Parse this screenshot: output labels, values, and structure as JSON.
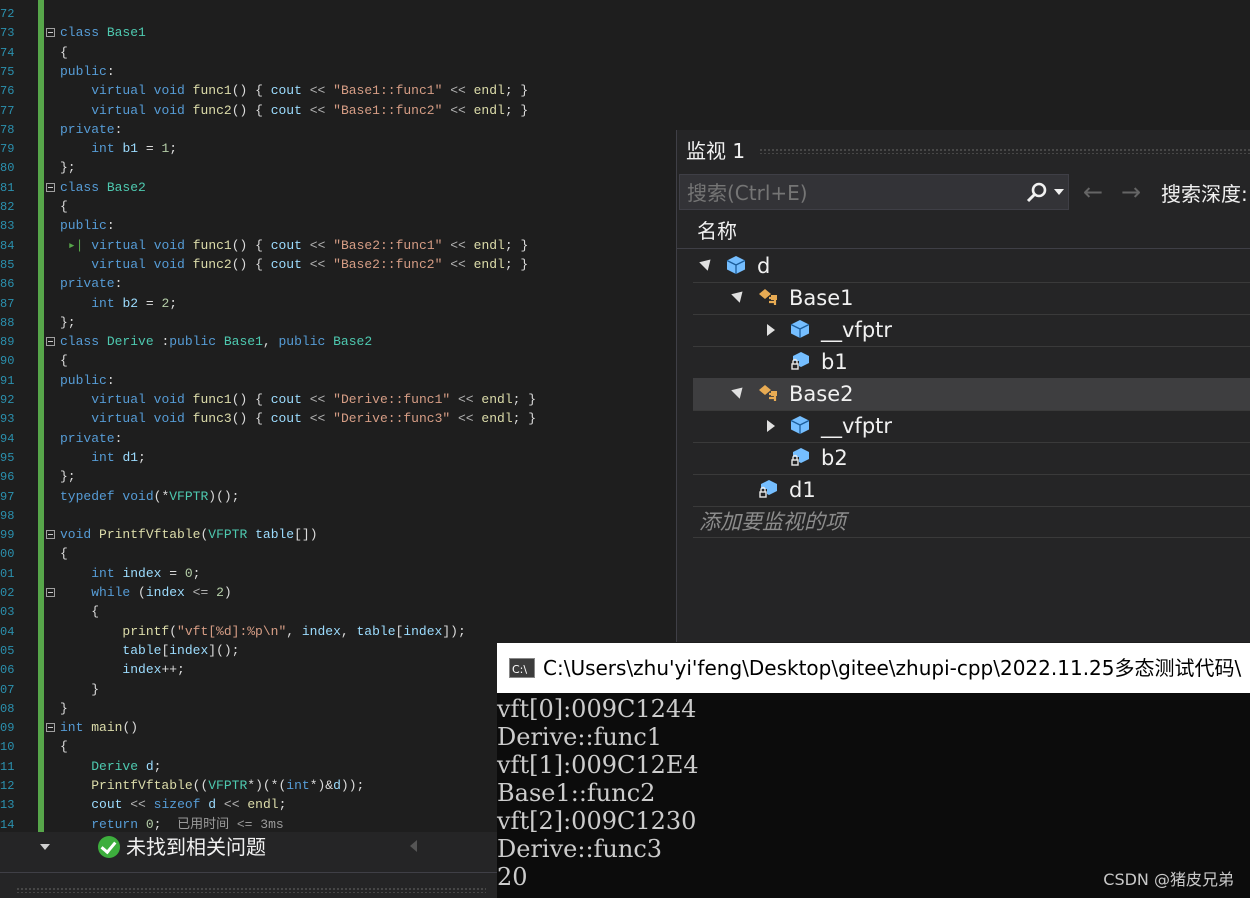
{
  "editor": {
    "lines": [
      {
        "n": "72",
        "html": ""
      },
      {
        "n": "73",
        "fold": true,
        "html": "<span class='kw'>class</span> <span class='ty'>Base1</span>"
      },
      {
        "n": "74",
        "html": "{"
      },
      {
        "n": "75",
        "html": "<span class='kw'>public</span>:"
      },
      {
        "n": "76",
        "html": "    <span class='kw'>virtual</span> <span class='kw'>void</span> <span class='fn'>func1</span>() { <span class='va'>cout</span> <span class='op'>&lt;&lt;</span> <span class='st'>\"Base1::func1\"</span> <span class='op'>&lt;&lt;</span> <span class='fn'>endl</span>; }"
      },
      {
        "n": "77",
        "html": "    <span class='kw'>virtual</span> <span class='kw'>void</span> <span class='fn'>func2</span>() { <span class='va'>cout</span> <span class='op'>&lt;&lt;</span> <span class='st'>\"Base1::func2\"</span> <span class='op'>&lt;&lt;</span> <span class='fn'>endl</span>; }"
      },
      {
        "n": "78",
        "html": "<span class='kw'>private</span>:"
      },
      {
        "n": "79",
        "html": "    <span class='kw'>int</span> <span class='va'>b1</span> = <span class='nu'>1</span>;"
      },
      {
        "n": "80",
        "html": "};"
      },
      {
        "n": "81",
        "fold": true,
        "html": "<span class='kw'>class</span> <span class='ty'>Base2</span>"
      },
      {
        "n": "82",
        "html": "{"
      },
      {
        "n": "83",
        "html": "<span class='kw'>public</span>:"
      },
      {
        "n": "84",
        "html": " <span class='bp'>▸|</span> <span class='kw'>virtual</span> <span class='kw'>void</span> <span class='fn'>func1</span>() { <span class='va'>cout</span> <span class='op'>&lt;&lt;</span> <span class='st'>\"Base2::func1\"</span> <span class='op'>&lt;&lt;</span> <span class='fn'>endl</span>; }"
      },
      {
        "n": "85",
        "html": "    <span class='kw'>virtual</span> <span class='kw'>void</span> <span class='fn'>func2</span>() { <span class='va'>cout</span> <span class='op'>&lt;&lt;</span> <span class='st'>\"Base2::func2\"</span> <span class='op'>&lt;&lt;</span> <span class='fn'>endl</span>; }"
      },
      {
        "n": "86",
        "html": "<span class='kw'>private</span>:"
      },
      {
        "n": "87",
        "html": "    <span class='kw'>int</span> <span class='va'>b2</span> = <span class='nu'>2</span>;"
      },
      {
        "n": "88",
        "html": "};"
      },
      {
        "n": "89",
        "fold": true,
        "html": "<span class='kw'>class</span> <span class='ty'>Derive</span> :<span class='kw'>public</span> <span class='ty'>Base1</span>, <span class='kw'>public</span> <span class='ty'>Base2</span>"
      },
      {
        "n": "90",
        "html": "{"
      },
      {
        "n": "91",
        "html": "<span class='kw'>public</span>:"
      },
      {
        "n": "92",
        "html": "    <span class='kw'>virtual</span> <span class='kw'>void</span> <span class='fn'>func1</span>() { <span class='va'>cout</span> <span class='op'>&lt;&lt;</span> <span class='st'>\"Derive::func1\"</span> <span class='op'>&lt;&lt;</span> <span class='fn'>endl</span>; }"
      },
      {
        "n": "93",
        "html": "    <span class='kw'>virtual</span> <span class='kw'>void</span> <span class='fn'>func3</span>() { <span class='va'>cout</span> <span class='op'>&lt;&lt;</span> <span class='st'>\"Derive::func3\"</span> <span class='op'>&lt;&lt;</span> <span class='fn'>endl</span>; }"
      },
      {
        "n": "94",
        "html": "<span class='kw'>private</span>:"
      },
      {
        "n": "95",
        "html": "    <span class='kw'>int</span> <span class='va'>d1</span>;"
      },
      {
        "n": "96",
        "html": "};"
      },
      {
        "n": "97",
        "html": "<span class='kw'>typedef</span> <span class='kw'>void</span>(*<span class='ty'>VFPTR</span>)();"
      },
      {
        "n": "98",
        "html": ""
      },
      {
        "n": "99",
        "fold": true,
        "html": "<span class='kw'>void</span> <span class='fn'>PrintfVftable</span>(<span class='ty'>VFPTR</span> <span class='va'>table</span>[])"
      },
      {
        "n": "00",
        "html": "{"
      },
      {
        "n": "01",
        "html": "    <span class='kw'>int</span> <span class='va'>index</span> = <span class='nu'>0</span>;"
      },
      {
        "n": "02",
        "fold": true,
        "html": "    <span class='kw'>while</span> (<span class='va'>index</span> <span class='op'>&lt;=</span> <span class='nu'>2</span>)"
      },
      {
        "n": "03",
        "html": "    {"
      },
      {
        "n": "04",
        "html": "        <span class='fn'>printf</span>(<span class='st'>\"vft[%d]:%p\\n\"</span>, <span class='va'>index</span>, <span class='va'>table</span>[<span class='va'>index</span>]);"
      },
      {
        "n": "05",
        "html": "        <span class='va'>table</span>[<span class='va'>index</span>]();"
      },
      {
        "n": "06",
        "html": "        <span class='va'>index</span>++;"
      },
      {
        "n": "07",
        "html": "    }"
      },
      {
        "n": "08",
        "html": "}"
      },
      {
        "n": "09",
        "fold": true,
        "html": "<span class='kw'>int</span> <span class='fn'>main</span>()"
      },
      {
        "n": "10",
        "html": "{"
      },
      {
        "n": "11",
        "html": "    <span class='ty'>Derive</span> <span class='va'>d</span>;"
      },
      {
        "n": "12",
        "html": "    <span class='fn'>PrintfVftable</span>((<span class='ty'>VFPTR</span>*)(*(<span class='kw'>int</span>*)&amp;<span class='va'>d</span>));"
      },
      {
        "n": "13",
        "html": "    <span class='va'>cout</span> <span class='op'>&lt;&lt;</span> <span class='kw'>sizeof</span> <span class='va'>d</span> <span class='op'>&lt;&lt;</span> <span class='fn'>endl</span>;"
      },
      {
        "n": "14",
        "html": "    <span class='kw'>return</span> <span class='nu'>0</span>;  <span class='cm'>已用时间 &lt;= 3ms</span>"
      }
    ]
  },
  "watch": {
    "title": "监视 1",
    "search_placeholder": "搜索(Ctrl+E)",
    "depth_label": "搜索深度:",
    "column_name": "名称",
    "rows": [
      {
        "name": "d",
        "indent": 0,
        "expander": "open",
        "icon": "object-icon"
      },
      {
        "name": "Base1",
        "indent": 1,
        "expander": "open",
        "icon": "base-class-icon"
      },
      {
        "name": "__vfptr",
        "indent": 2,
        "expander": "closed",
        "icon": "object-icon"
      },
      {
        "name": "b1",
        "indent": 2,
        "expander": "none",
        "icon": "private-field-icon"
      },
      {
        "name": "Base2",
        "indent": 1,
        "expander": "open",
        "icon": "base-class-icon",
        "selected": true
      },
      {
        "name": "__vfptr",
        "indent": 2,
        "expander": "closed",
        "icon": "object-icon"
      },
      {
        "name": "b2",
        "indent": 2,
        "expander": "none",
        "icon": "private-field-icon"
      },
      {
        "name": "d1",
        "indent": 1,
        "expander": "none",
        "icon": "private-field-icon"
      }
    ],
    "add_item": "添加要监视的项"
  },
  "console": {
    "icon_text": "C:\\",
    "title": "C:\\Users\\zhu'yi'feng\\Desktop\\gitee\\zhupi-cpp\\2022.11.25多态测试代码\\",
    "output": [
      "vft[0]:009C1244",
      "Derive::func1",
      "vft[1]:009C12E4",
      "Base1::func2",
      "vft[2]:009C1230",
      "Derive::func3",
      "20"
    ],
    "watermark": "CSDN @猪皮兄弟"
  },
  "status": {
    "message": "未找到相关问题"
  },
  "colors": {
    "accent_green": "#57a64a",
    "keyword": "#569cd6",
    "type": "#4ec9b0",
    "string": "#d69d85"
  }
}
